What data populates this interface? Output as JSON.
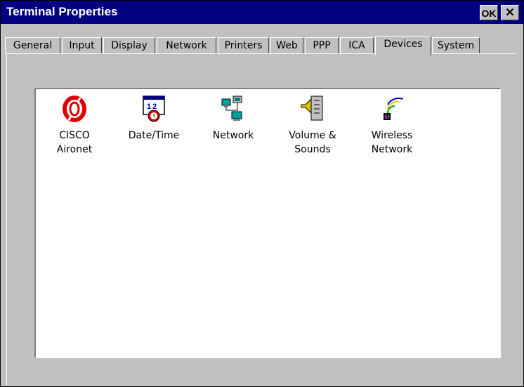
{
  "window": {
    "title": "Terminal Properties",
    "ok_label": "OK",
    "close_label": "✕"
  },
  "tabs": [
    {
      "label": "General",
      "active": false
    },
    {
      "label": "Input",
      "active": false
    },
    {
      "label": "Display",
      "active": false
    },
    {
      "label": "Network",
      "active": false
    },
    {
      "label": "Printers",
      "active": false
    },
    {
      "label": "Web",
      "active": false
    },
    {
      "label": "PPP",
      "active": false
    },
    {
      "label": "ICA",
      "active": false
    },
    {
      "label": "Devices",
      "active": true
    },
    {
      "label": "System",
      "active": false
    }
  ],
  "devices": [
    {
      "label": "CISCO\nAironet",
      "icon": "cisco-aironet-icon"
    },
    {
      "label": "Date/Time",
      "icon": "date-time-icon"
    },
    {
      "label": "Network",
      "icon": "network-icon"
    },
    {
      "label": "Volume &\nSounds",
      "icon": "volume-sounds-icon"
    },
    {
      "label": "Wireless\nNetwork",
      "icon": "wireless-network-icon"
    }
  ],
  "colors": {
    "titlebar": "#000080",
    "face": "#c0c0c0",
    "panel": "#ffffff"
  }
}
